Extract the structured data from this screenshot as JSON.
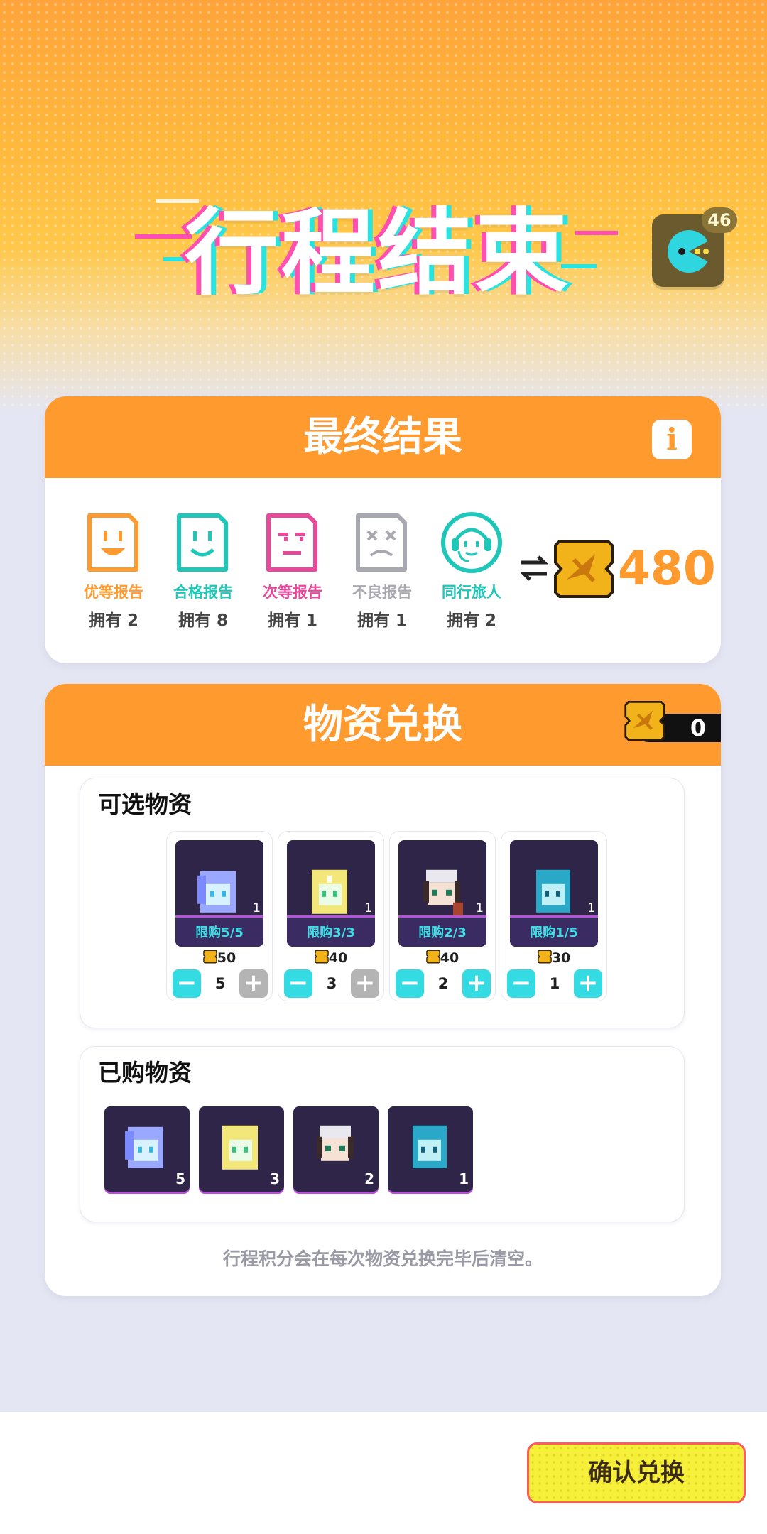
{
  "header": {
    "title": "行程结束",
    "avatar_badge": "46"
  },
  "result_card": {
    "title": "最终结果",
    "info_icon_label": "i",
    "reports": [
      {
        "label": "优等报告",
        "owned": "拥有 2",
        "color": "#ff9a2e",
        "icon": "happy-report-icon"
      },
      {
        "label": "合格报告",
        "owned": "拥有 8",
        "color": "#1fc7b8",
        "icon": "smile-report-icon"
      },
      {
        "label": "次等报告",
        "owned": "拥有 1",
        "color": "#e9489b",
        "icon": "meh-report-icon"
      },
      {
        "label": "不良报告",
        "owned": "拥有 1",
        "color": "#a8a8b0",
        "icon": "dead-report-icon"
      },
      {
        "label": "同行旅人",
        "owned": "拥有 2",
        "color": "#1fc7b8",
        "icon": "headset-companion-icon"
      }
    ],
    "points_value": "480"
  },
  "exchange_card": {
    "title": "物资兑换",
    "points_balance": "0",
    "available_title": "可选物资",
    "items": [
      {
        "limit": "限购5/5",
        "count": "1",
        "price": "50",
        "qty": "5",
        "plus_enabled": false
      },
      {
        "limit": "限购3/3",
        "count": "1",
        "price": "40",
        "qty": "3",
        "plus_enabled": false
      },
      {
        "limit": "限购2/3",
        "count": "1",
        "price": "40",
        "qty": "2",
        "plus_enabled": true
      },
      {
        "limit": "限购1/5",
        "count": "1",
        "price": "30",
        "qty": "1",
        "plus_enabled": true
      }
    ],
    "purchased_title": "已购物资",
    "purchased": [
      {
        "count": "5"
      },
      {
        "count": "3"
      },
      {
        "count": "2"
      },
      {
        "count": "1"
      }
    ],
    "note": "行程积分会在每次物资兑换完毕后清空。"
  },
  "footer": {
    "confirm_label": "确认兑换"
  },
  "colors": {
    "accent": "#ff9a2e",
    "teal": "#34dbe3",
    "confirm_bg": "#f6f03b"
  }
}
